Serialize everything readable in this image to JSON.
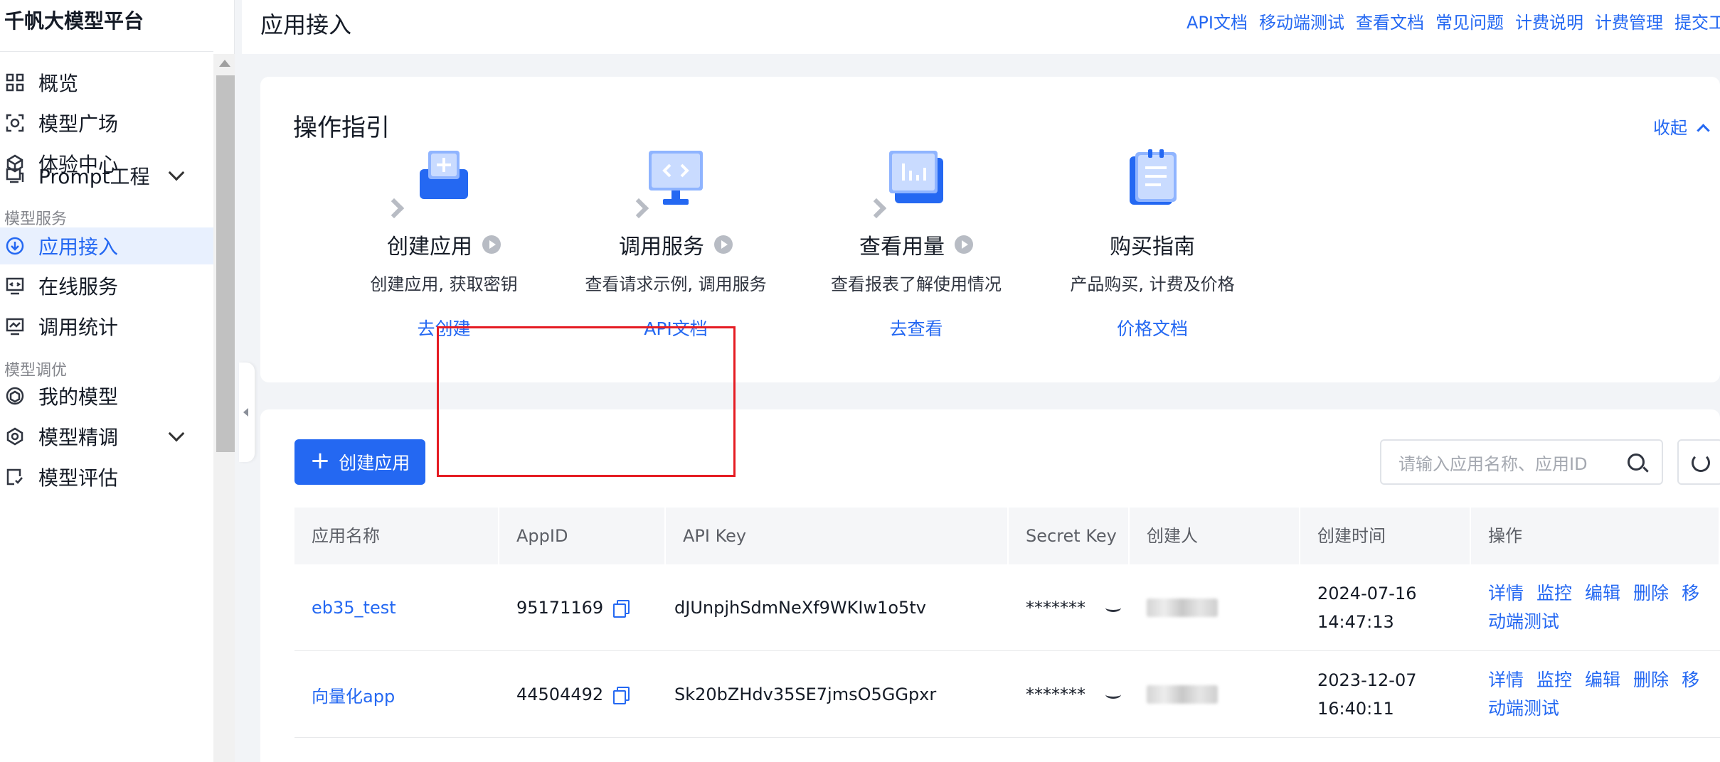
{
  "sidebar": {
    "brand": "千帆大模型平台",
    "items": [
      {
        "label": "概览",
        "icon": "grid-icon"
      },
      {
        "label": "模型广场",
        "icon": "model-square-icon"
      },
      {
        "label": "体验中心",
        "icon": "experience-icon"
      },
      {
        "label": "Prompt工程",
        "icon": "prompt-icon"
      },
      {
        "label": "应用接入",
        "icon": "app-access-icon"
      },
      {
        "label": "在线服务",
        "icon": "online-service-icon"
      },
      {
        "label": "调用统计",
        "icon": "stats-icon"
      },
      {
        "label": "我的模型",
        "icon": "my-model-icon"
      },
      {
        "label": "模型精调",
        "icon": "finetune-icon"
      },
      {
        "label": "模型评估",
        "icon": "evaluate-icon"
      }
    ],
    "sections": [
      "模型服务",
      "模型调优"
    ]
  },
  "header": {
    "title": "应用接入",
    "links": [
      "API文档",
      "移动端测试",
      "查看文档",
      "常见问题",
      "计费说明",
      "计费管理",
      "提交工"
    ]
  },
  "guide": {
    "title": "操作指引",
    "collapse_label": "收起",
    "steps": [
      {
        "title": "创建应用",
        "desc": "创建应用, 获取密钥",
        "link": "去创建"
      },
      {
        "title": "调用服务",
        "desc": "查看请求示例, 调用服务",
        "link": "API文档"
      },
      {
        "title": "查看用量",
        "desc": "查看报表了解使用情况",
        "link": "去查看"
      },
      {
        "title": "购买指南",
        "desc": "产品购买, 计费及价格",
        "link": "价格文档"
      }
    ]
  },
  "toolbar": {
    "create_label": "创建应用",
    "search_placeholder": "请输入应用名称、应用ID"
  },
  "table": {
    "columns": [
      "应用名称",
      "AppID",
      "API Key",
      "Secret Key",
      "创建人",
      "创建时间",
      "操作"
    ],
    "rows": [
      {
        "name": "eb35_test",
        "app_id": "95171169",
        "api_key": "dJUnpjhSdmNeXf9WKIw1o5tv",
        "secret_key": "*******",
        "date": "2024-07-16",
        "time": "14:47:13"
      },
      {
        "name": "向量化app",
        "app_id": "44504492",
        "api_key": "Sk20bZHdv35SE7jmsO5GGpxr",
        "secret_key": "*******",
        "date": "2023-12-07",
        "time": "16:40:11"
      }
    ],
    "actions": [
      "详情",
      "监控",
      "编辑",
      "删除",
      "移",
      "动端测试"
    ]
  },
  "colors": {
    "accent": "#2468f2",
    "highlight": "#e51c23"
  }
}
